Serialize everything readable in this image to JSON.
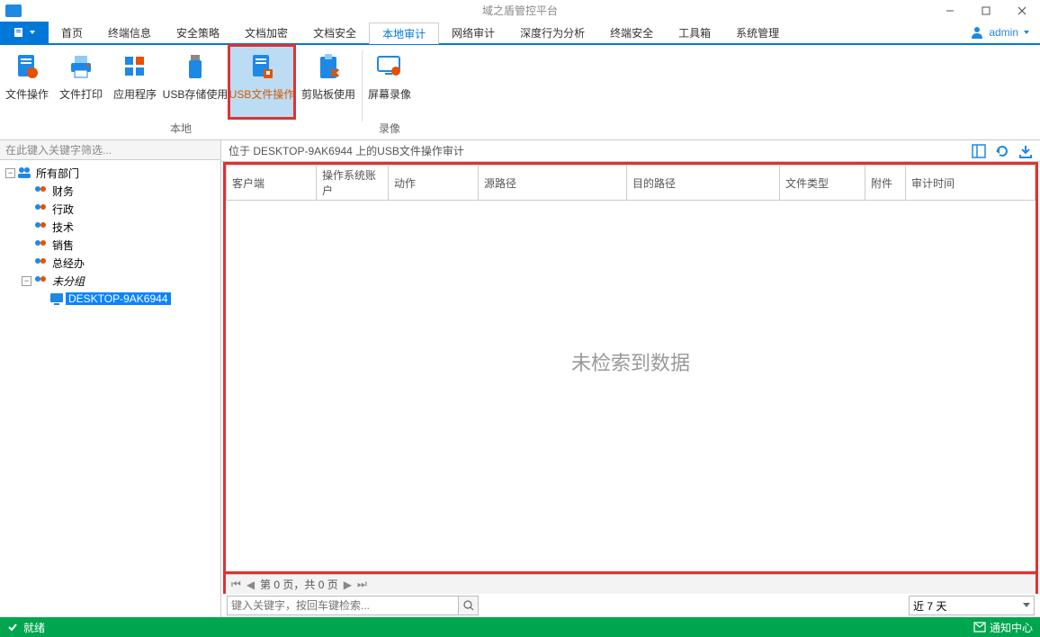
{
  "app_title": "域之盾管控平台",
  "menu": {
    "items": [
      "首页",
      "终端信息",
      "安全策略",
      "文档加密",
      "文档安全",
      "本地审计",
      "网络审计",
      "深度行为分析",
      "终端安全",
      "工具箱",
      "系统管理"
    ],
    "active_index": 5
  },
  "user": {
    "name": "admin"
  },
  "ribbon": {
    "group1_label": "本地",
    "group2_label": "录像",
    "items": [
      {
        "label": "文件操作"
      },
      {
        "label": "文件打印"
      },
      {
        "label": "应用程序"
      },
      {
        "label": "USB存储使用"
      },
      {
        "label": "USB文件操作",
        "selected": true
      },
      {
        "label": "剪贴板使用"
      },
      {
        "label": "屏幕录像"
      }
    ]
  },
  "sidebar": {
    "placeholder": "在此键入关键字筛选...",
    "root": "所有部门",
    "depts": [
      "财务",
      "行政",
      "技术",
      "销售",
      "总经办"
    ],
    "ungrouped": "未分组",
    "host": "DESKTOP-9AK6944"
  },
  "context": {
    "text": "位于 DESKTOP-9AK6944 上的USB文件操作审计"
  },
  "grid": {
    "columns": [
      "客户端",
      "操作系统账户",
      "动作",
      "源路径",
      "目的路径",
      "文件类型",
      "附件",
      "审计时间"
    ],
    "no_data": "未检索到数据"
  },
  "pager": {
    "text": "第 0 页，共 0 页"
  },
  "filter": {
    "search_placeholder": "键入关键字，按回车键检索...",
    "date_range": "近 7 天"
  },
  "status": {
    "text": "就绪",
    "notify": "通知中心"
  }
}
